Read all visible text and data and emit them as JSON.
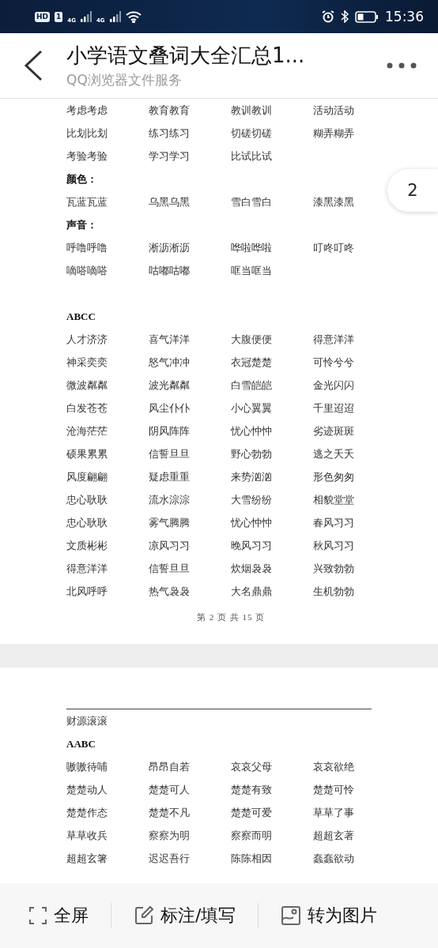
{
  "status_bar": {
    "hd": "HD",
    "sim": "1",
    "networks": [
      "4G",
      "4G"
    ],
    "time": "15:36"
  },
  "header": {
    "title": "小学语文叠词大全汇总1...",
    "subtitle": "QQ浏览器文件服务"
  },
  "page_badge": "2",
  "pages": [
    {
      "top_rule": false,
      "sections": [
        [
          {
            "kind": "row",
            "cells": [
              "考虑考虑",
              "教育教育",
              "教训教训",
              "活动活动"
            ]
          },
          {
            "kind": "row",
            "cells": [
              "比划比划",
              "练习练习",
              "切磋切磋",
              "糊弄糊弄"
            ]
          },
          {
            "kind": "row",
            "cells": [
              "考验考验",
              "学习学习",
              "比试比试"
            ]
          },
          {
            "kind": "heading",
            "text": "颜色："
          },
          {
            "kind": "row",
            "cells": [
              "瓦蓝瓦蓝",
              "乌黑乌黑",
              "雪白雪白",
              "漆黑漆黑"
            ]
          },
          {
            "kind": "heading",
            "text": "声音："
          },
          {
            "kind": "row",
            "cells": [
              "呼噜呼噜",
              "淅沥淅沥",
              "哗啦哗啦",
              "叮咚叮咚"
            ]
          },
          {
            "kind": "row",
            "cells": [
              "嘀嗒嘀嗒",
              "咕嘟咕嘟",
              "哐当哐当"
            ]
          }
        ],
        [
          {
            "kind": "heading",
            "text": "ABCC"
          },
          {
            "kind": "row",
            "cells": [
              "人才济济",
              "喜气洋洋",
              "大腹便便",
              "得意洋洋"
            ]
          },
          {
            "kind": "row",
            "cells": [
              "神采奕奕",
              "怒气冲冲",
              "衣冠楚楚",
              "可怜兮兮"
            ]
          },
          {
            "kind": "row",
            "cells": [
              "微波粼粼",
              "波光粼粼",
              "白雪皑皑",
              "金光闪闪"
            ]
          },
          {
            "kind": "row",
            "cells": [
              "白发苍苍",
              "风尘仆仆",
              "小心翼翼",
              "千里迢迢"
            ]
          },
          {
            "kind": "row",
            "cells": [
              "沧海茫茫",
              "阴风阵阵",
              "忧心忡忡",
              "劣迹斑斑"
            ]
          },
          {
            "kind": "row",
            "cells": [
              "硕果累累",
              "信誓旦旦",
              "野心勃勃",
              "逃之夭夭"
            ]
          },
          {
            "kind": "row",
            "cells": [
              "风度翩翩",
              "疑虑重重",
              "来势汹汹",
              "形色匆匆"
            ]
          },
          {
            "kind": "row",
            "cells": [
              "忠心耿耿",
              "流水淙淙",
              "大雪纷纷",
              "相貌堂堂"
            ]
          },
          {
            "kind": "row",
            "cells": [
              "忠心耿耿",
              "雾气腾腾",
              "忧心忡忡",
              "春风习习"
            ]
          },
          {
            "kind": "row",
            "cells": [
              "文质彬彬",
              "凉风习习",
              "晚风习习",
              "秋风习习"
            ]
          },
          {
            "kind": "row",
            "cells": [
              "得意洋洋",
              "信誓旦旦",
              "炊烟袅袅",
              "兴致勃勃"
            ]
          },
          {
            "kind": "row",
            "cells": [
              "北风呼呼",
              "热气袅袅",
              "大名鼎鼎",
              "生机勃勃"
            ]
          }
        ]
      ],
      "footer": "第 2 页 共 15 页"
    },
    {
      "top_rule": true,
      "sections": [
        [
          {
            "kind": "line",
            "text": "财源滚滚"
          },
          {
            "kind": "heading",
            "text": "AABC"
          },
          {
            "kind": "row",
            "cells": [
              "嗷嗷待哺",
              "昂昂自若",
              "哀哀父母",
              "哀哀欲绝"
            ]
          },
          {
            "kind": "row",
            "cells": [
              "楚楚动人",
              "楚楚可人",
              "楚楚有致",
              "楚楚可怜"
            ]
          },
          {
            "kind": "row",
            "cells": [
              "楚楚作态",
              "楚楚不凡",
              "楚楚可爱",
              "草草了事"
            ]
          },
          {
            "kind": "row",
            "cells": [
              "草草收兵",
              "察察为明",
              "察察而明",
              "超超玄著"
            ]
          },
          {
            "kind": "row",
            "cells": [
              "超超玄箸",
              "迟迟吾行",
              "陈陈相因",
              "蠢蠢欲动"
            ]
          }
        ]
      ]
    }
  ],
  "toolbar": [
    {
      "kind": "fullscreen",
      "label": "全屏"
    },
    {
      "kind": "edit",
      "label": "标注/填写"
    },
    {
      "kind": "image",
      "label": "转为图片"
    }
  ]
}
